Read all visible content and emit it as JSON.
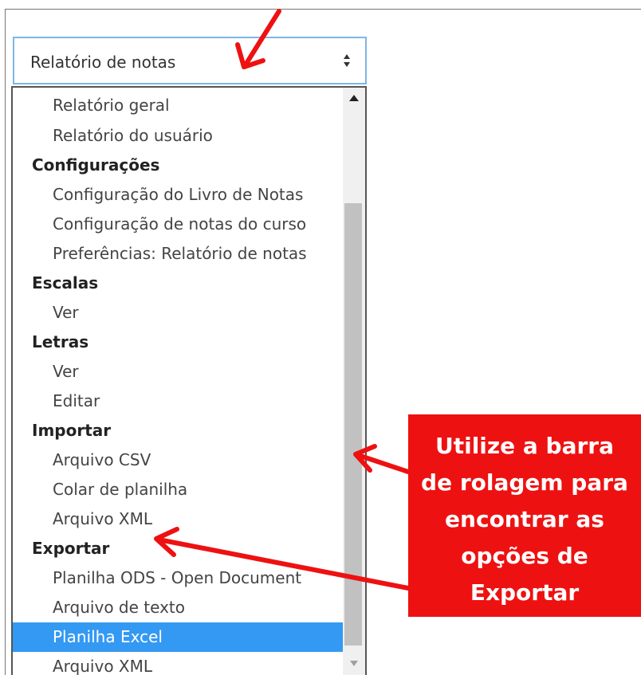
{
  "select": {
    "value": "Relatório de notas"
  },
  "list": {
    "rows": [
      {
        "label": "Relatório geral",
        "kind": "option",
        "selected": false
      },
      {
        "label": "Relatório do usuário",
        "kind": "option",
        "selected": false
      },
      {
        "label": "Configurações",
        "kind": "group",
        "selected": false
      },
      {
        "label": "Configuração do Livro de Notas",
        "kind": "option",
        "selected": false
      },
      {
        "label": "Configuração de notas do curso",
        "kind": "option",
        "selected": false
      },
      {
        "label": "Preferências: Relatório de notas",
        "kind": "option",
        "selected": false
      },
      {
        "label": "Escalas",
        "kind": "group",
        "selected": false
      },
      {
        "label": "Ver",
        "kind": "option",
        "selected": false
      },
      {
        "label": "Letras",
        "kind": "group",
        "selected": false
      },
      {
        "label": "Ver",
        "kind": "option",
        "selected": false
      },
      {
        "label": "Editar",
        "kind": "option",
        "selected": false
      },
      {
        "label": "Importar",
        "kind": "group",
        "selected": false
      },
      {
        "label": "Arquivo CSV",
        "kind": "option",
        "selected": false
      },
      {
        "label": "Colar de planilha",
        "kind": "option",
        "selected": false
      },
      {
        "label": "Arquivo XML",
        "kind": "option",
        "selected": false
      },
      {
        "label": "Exportar",
        "kind": "group",
        "selected": false
      },
      {
        "label": "Planilha ODS - Open Document",
        "kind": "option",
        "selected": false
      },
      {
        "label": "Arquivo de texto",
        "kind": "option",
        "selected": false
      },
      {
        "label": "Planilha Excel",
        "kind": "option",
        "selected": true
      },
      {
        "label": "Arquivo XML",
        "kind": "option",
        "selected": false
      }
    ]
  },
  "callout": {
    "lines": [
      "Utilize a barra",
      "de rolagem para",
      "encontrar as",
      "opções de",
      "Exportar"
    ]
  },
  "colors": {
    "selection": "#3399f3",
    "callout_bg": "#ee1111",
    "arrow": "#ee1111",
    "focus_border": "#7fb6e6"
  }
}
